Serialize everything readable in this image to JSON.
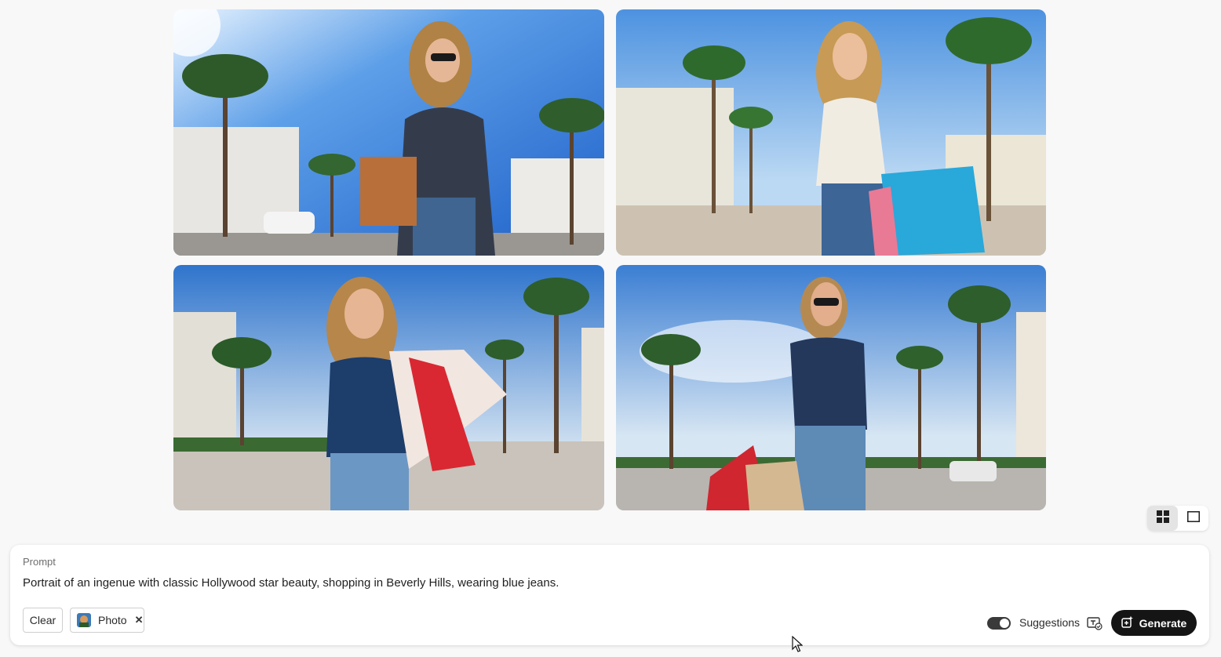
{
  "images": [
    {
      "label": "Woman in sunglasses holding brown shopping bag on palm-lined street"
    },
    {
      "label": "Woman in white top with blue and pink shopping bags"
    },
    {
      "label": "Smiling woman carrying red and striped shopping bags"
    },
    {
      "label": "Woman in sunglasses with shopping bags on palm street"
    }
  ],
  "view_modes": [
    {
      "icon": "grid-view-icon",
      "active": true
    },
    {
      "icon": "single-view-icon",
      "active": false
    }
  ],
  "prompt": {
    "label": "Prompt",
    "text": "Portrait of an ingenue with classic Hollywood star beauty, shopping in Beverly Hills, wearing blue jeans."
  },
  "chips": {
    "clear_label": "Clear",
    "style_label": "Photo"
  },
  "suggestions": {
    "label": "Suggestions",
    "enabled": true
  },
  "generate": {
    "label": "Generate"
  },
  "colors": {
    "accent": "#151515",
    "background": "#f8f8f8",
    "sky": "#2a6fd6"
  }
}
